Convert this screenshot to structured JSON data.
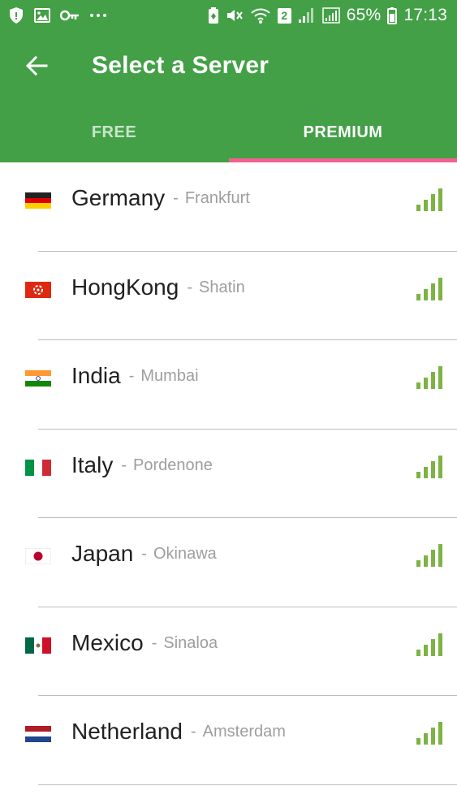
{
  "status_bar": {
    "left_icons": [
      "shield-icon",
      "image-icon",
      "key-icon",
      "more-dots-icon"
    ],
    "sim_badge": "2",
    "battery_percent": "65%",
    "time": "17:13"
  },
  "toolbar": {
    "title": "Select a Server",
    "back_icon": "arrow-back-icon"
  },
  "tabs": [
    {
      "label": "FREE",
      "selected": false
    },
    {
      "label": "PREMIUM",
      "selected": true
    }
  ],
  "colors": {
    "header": "#43a047",
    "tab_indicator": "#f06292",
    "signal": "#7cb342"
  },
  "servers": [
    {
      "country": "Germany",
      "city": "Frankfurt",
      "flag": "germany-flag-icon",
      "signal_bars": 4
    },
    {
      "country": "HongKong",
      "city": "Shatin",
      "flag": "hongkong-flag-icon",
      "signal_bars": 4
    },
    {
      "country": "India",
      "city": "Mumbai",
      "flag": "india-flag-icon",
      "signal_bars": 4
    },
    {
      "country": "Italy",
      "city": "Pordenone",
      "flag": "italy-flag-icon",
      "signal_bars": 4
    },
    {
      "country": "Japan",
      "city": "Okinawa",
      "flag": "japan-flag-icon",
      "signal_bars": 4
    },
    {
      "country": "Mexico",
      "city": "Sinaloa",
      "flag": "mexico-flag-icon",
      "signal_bars": 4
    },
    {
      "country": "Netherland",
      "city": "Amsterdam",
      "flag": "netherlands-flag-icon",
      "signal_bars": 4
    }
  ]
}
